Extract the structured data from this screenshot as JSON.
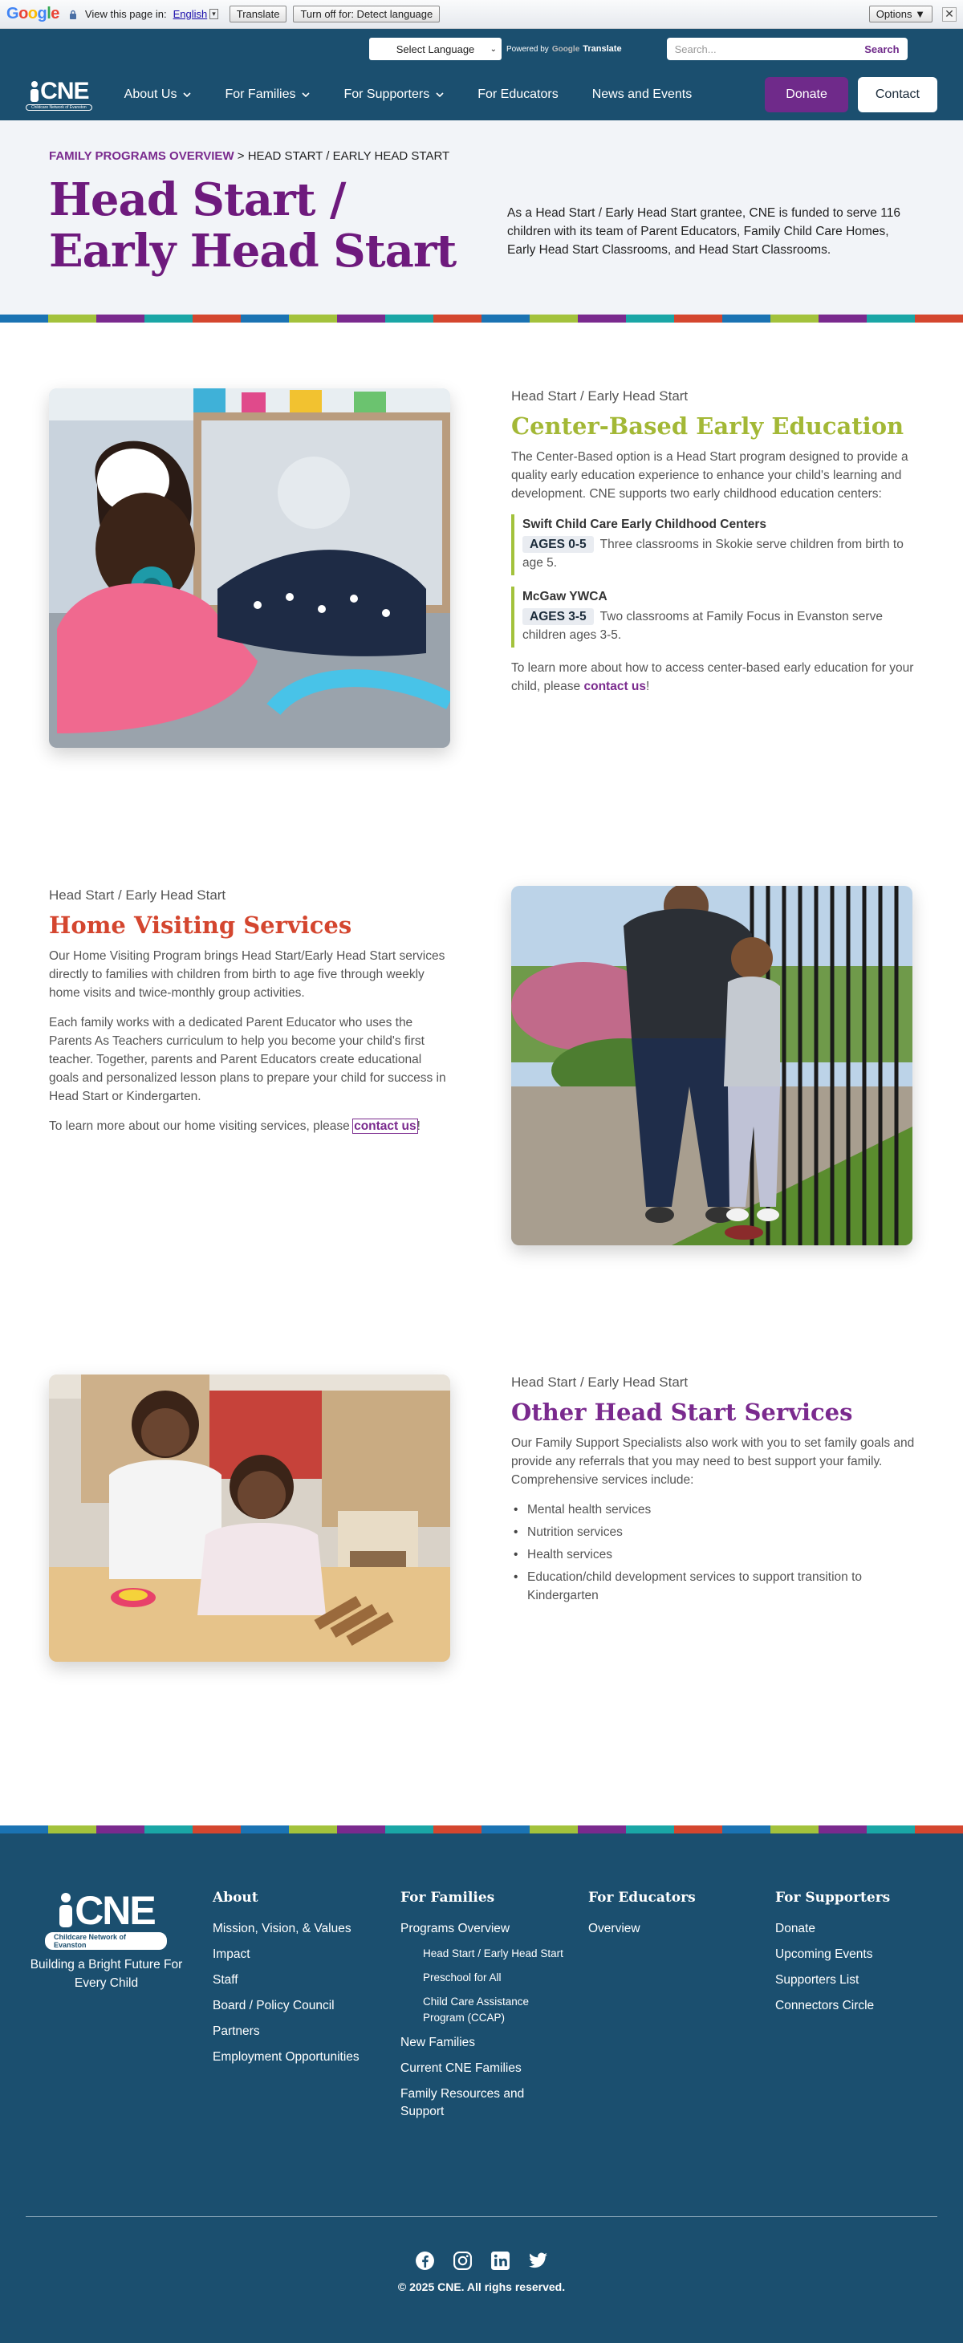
{
  "translate_bar": {
    "logo": "Google",
    "view_text": "View this page in:",
    "language": "English",
    "translate_button": "Translate",
    "turn_off_button": "Turn off for: Detect language",
    "options_button": "Options ▼",
    "close": "✕"
  },
  "utility": {
    "select_language": "Select Language",
    "powered_by": "Powered by",
    "google": "Google",
    "translate": "Translate",
    "search_placeholder": "Search...",
    "search_button": "Search"
  },
  "nav": {
    "logo": "CNE",
    "logo_sub": "Childcare Network of Evanston",
    "items": [
      {
        "label": "About Us",
        "has_dropdown": true
      },
      {
        "label": "For Families",
        "has_dropdown": true
      },
      {
        "label": "For Supporters",
        "has_dropdown": true
      },
      {
        "label": "For Educators",
        "has_dropdown": false
      },
      {
        "label": "News and Events",
        "has_dropdown": false
      }
    ],
    "donate": "Donate",
    "contact": "Contact"
  },
  "hero": {
    "breadcrumb_parent": "FAMILY PROGRAMS OVERVIEW",
    "breadcrumb_sep": " > ",
    "breadcrumb_current": "HEAD START / EARLY HEAD START",
    "title": "Head Start / Early Head Start",
    "intro": "As a Head Start / Early Head Start grantee, CNE is funded to serve 116 children with its team of Parent Educators, Family Child Care Homes, Early Head Start Classrooms, and Head Start Classrooms."
  },
  "stripe_colors": [
    "#1b73b3",
    "#a3c23c",
    "#7a2a8e",
    "#1aa6a6",
    "#d4462f",
    "#1b73b3",
    "#a3c23c",
    "#7a2a8e",
    "#1aa6a6",
    "#d4462f",
    "#1b73b3",
    "#a3c23c",
    "#7a2a8e",
    "#1aa6a6",
    "#d4462f",
    "#1b73b3",
    "#a3c23c",
    "#7a2a8e",
    "#1aa6a6",
    "#d4462f"
  ],
  "section1": {
    "eyebrow": "Head Start / Early Head Start",
    "title": "Center-Based Early Education",
    "title_color": "#a3b836",
    "body": "The Center-Based option is a Head Start program designed to provide a quality early education experience to enhance your child's learning and development. CNE supports two early childhood education centers:",
    "locations": [
      {
        "name": "Swift Child Care Early Childhood Centers",
        "ages": "AGES 0-5",
        "desc": "Three classrooms in Skokie serve children from birth to age 5."
      },
      {
        "name": "McGaw YWCA",
        "ages": "AGES 3-5",
        "desc": "Two classrooms at Family Focus in Evanston serve children ages 3-5."
      }
    ],
    "cta_prefix": "To learn more about how to access center-based early education for your child, please ",
    "cta_link": "contact us",
    "cta_suffix": "!"
  },
  "section2": {
    "eyebrow": "Head Start / Early Head Start",
    "title": "Home Visiting Services",
    "title_color": "#d4462f",
    "body1": "Our Home Visiting Program brings Head Start/Early Head Start services directly to families with children from birth to age five through weekly home visits and twice-monthly group activities.",
    "body2": "Each family works with a dedicated Parent Educator who uses the Parents As Teachers curriculum to help you become your child's first teacher. Together, parents and Parent Educators create educational goals and personalized lesson plans to prepare your child for success in Head Start or Kindergarten.",
    "cta_prefix": "To learn more about our home visiting services, please ",
    "cta_link": "contact us",
    "cta_suffix": "!"
  },
  "section3": {
    "eyebrow": "Head Start / Early Head Start",
    "title": "Other Head Start Services",
    "title_color": "#7a2a8e",
    "body": "Our Family Support Specialists also work with you to set family goals and provide any referrals that you may need to best support your family. Comprehensive services include:",
    "services": [
      "Mental health services",
      "Nutrition services",
      "Health services",
      "Education/child development services to support transition to Kindergarten"
    ]
  },
  "footer": {
    "logo": "CNE",
    "logo_sub": "Childcare Network of Evanston",
    "tagline": "Building a Bright Future For Every Child",
    "about": {
      "heading": "About",
      "links": [
        "Mission, Vision, & Values",
        "Impact",
        "Staff",
        "Board / Policy Council",
        "Partners",
        "Employment Opportunities"
      ]
    },
    "families": {
      "heading": "For Families",
      "overview": "Programs Overview",
      "sub_links": [
        "Head Start / Early Head Start",
        "Preschool for All",
        "Child Care Assistance Program (CCAP)"
      ],
      "links": [
        "New Families",
        "Current CNE Families",
        "Family Resources and Support"
      ]
    },
    "educators": {
      "heading": "For Educators",
      "links": [
        "Overview"
      ]
    },
    "supporters": {
      "heading": "For Supporters",
      "links": [
        "Donate",
        "Upcoming Events",
        "Supporters List",
        "Connectors Circle"
      ]
    },
    "socials": [
      "facebook-icon",
      "instagram-icon",
      "linkedin-icon",
      "twitter-icon"
    ],
    "copyright": "© 2025 CNE. All righs reserved."
  }
}
